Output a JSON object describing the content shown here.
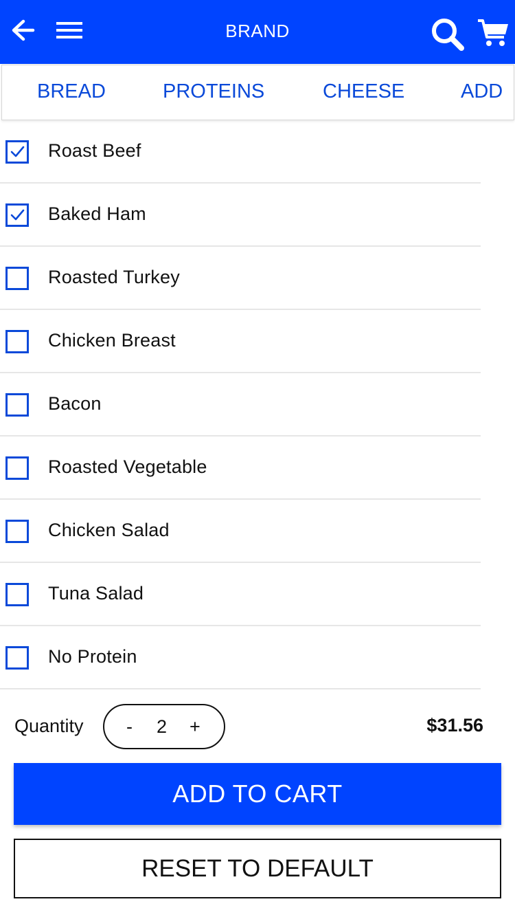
{
  "header": {
    "brand": "BRAND",
    "background_color": "#0044ff",
    "icons": [
      "back-arrow-icon",
      "hamburger-menu-icon",
      "search-icon",
      "cart-icon"
    ]
  },
  "tabs": [
    {
      "label": "BREAD"
    },
    {
      "label": "PROTEINS"
    },
    {
      "label": "CHEESE"
    },
    {
      "label": "ADD"
    }
  ],
  "options": [
    {
      "label": "Roast Beef",
      "checked": true
    },
    {
      "label": "Baked Ham",
      "checked": true
    },
    {
      "label": "Roasted Turkey",
      "checked": false
    },
    {
      "label": "Chicken Breast",
      "checked": false
    },
    {
      "label": "Bacon",
      "checked": false
    },
    {
      "label": "Roasted Vegetable",
      "checked": false
    },
    {
      "label": "Chicken Salad",
      "checked": false
    },
    {
      "label": "Tuna Salad",
      "checked": false
    },
    {
      "label": "No Protein",
      "checked": false
    }
  ],
  "quantity": {
    "label": "Quantity",
    "minus": "-",
    "value": "2",
    "plus": "+"
  },
  "price": "$31.56",
  "actions": {
    "add_to_cart": "ADD TO CART",
    "reset": "RESET TO DEFAULT"
  },
  "colors": {
    "accent": "#0044ff",
    "link": "#0a49d9"
  }
}
